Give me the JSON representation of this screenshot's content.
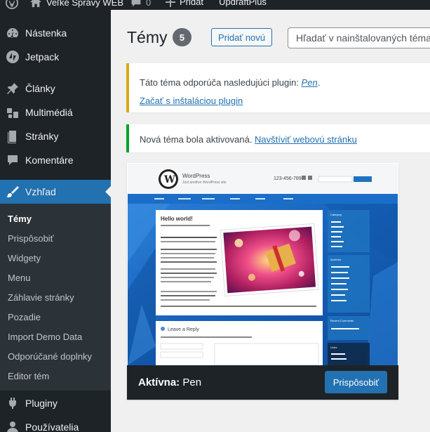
{
  "adminbar": {
    "site_name": "Veľké Správy WEB",
    "comments_count": "0",
    "new_label": "Pridať",
    "plugin_label": "UpdraftPlus"
  },
  "sidebar": {
    "items": [
      {
        "label": "Nástenka",
        "icon": "dashboard-icon"
      },
      {
        "label": "Jetpack",
        "icon": "jetpack-icon"
      },
      {
        "label": "Články",
        "icon": "pin-icon"
      },
      {
        "label": "Multimédiá",
        "icon": "media-icon"
      },
      {
        "label": "Stránky",
        "icon": "pages-icon"
      },
      {
        "label": "Komentáre",
        "icon": "comment-icon"
      },
      {
        "label": "Vzhľad",
        "icon": "brush-icon"
      },
      {
        "label": "Pluginy",
        "icon": "plugin-icon"
      },
      {
        "label": "Používatelia",
        "icon": "users-icon"
      }
    ],
    "submenu": [
      "Témy",
      "Prispôsobiť",
      "Widgety",
      "Menu",
      "Záhlavie stránky",
      "Pozadie",
      "Import Demo Data",
      "Odporúčané doplnky",
      "Editor tém"
    ]
  },
  "main": {
    "title": "Témy",
    "count": "5",
    "add_new": "Pridať novú",
    "search_placeholder": "Hľadať v nainštalovaných témach..."
  },
  "notices": {
    "plugin_text": "Táto téma odporúča nasledujúci plugin: ",
    "plugin_name": "Pen",
    "plugin_end": ".",
    "install_link": "Začať s inštaláciou plugin",
    "activated_text": "Nová téma bola aktivovaná. ",
    "visit_link": "Navštíviť webovú stránku"
  },
  "theme": {
    "active_label": "Aktívna:",
    "name": "Pen",
    "customize": "Prispôsobiť"
  },
  "preview": {
    "site_title": "WordPress",
    "tagline": "Just another WordPress site",
    "phone": "123-456-789",
    "post_title": "Hello world!",
    "reply_title": "Leave a Reply",
    "sidebar_titles": [
      "Category",
      "Archives",
      "Recent Comments",
      "Links"
    ]
  },
  "colors": {
    "admin_dark": "#1d2327",
    "accent": "#2271b1",
    "warning": "#dba617",
    "success": "#00a32a",
    "preview_blue": "#1a6ec7"
  }
}
